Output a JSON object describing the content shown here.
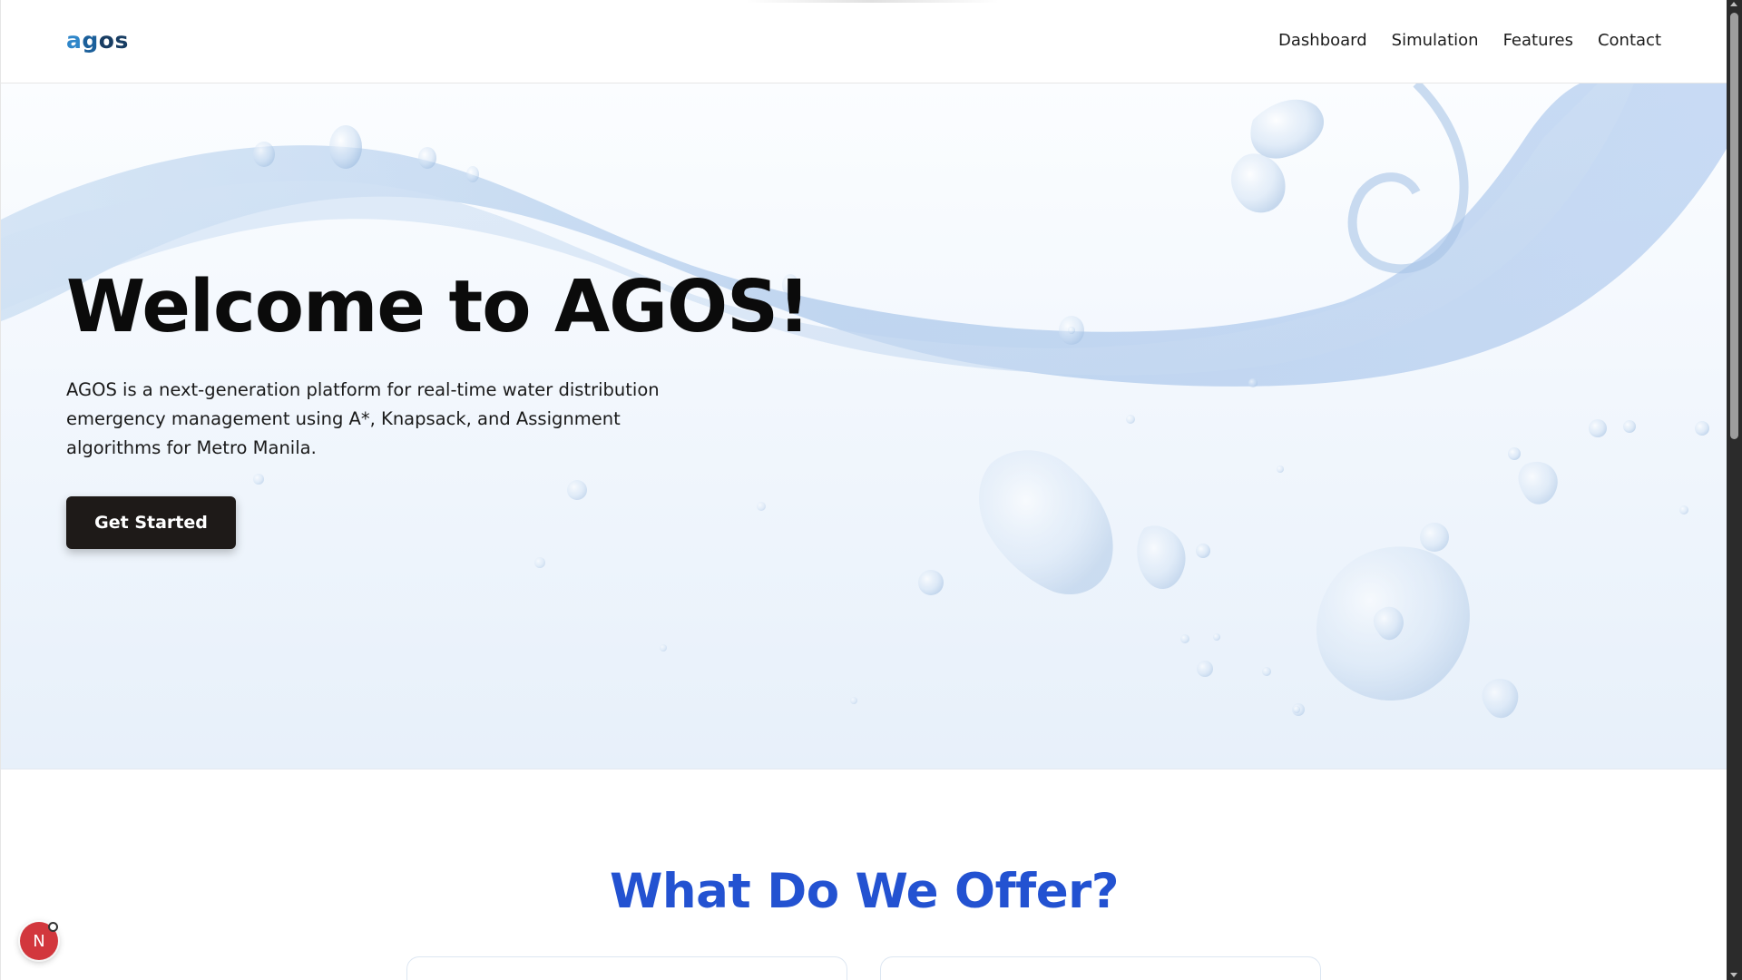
{
  "header": {
    "logo": {
      "part1": "a",
      "part2": "g",
      "part3": "os"
    },
    "nav": [
      {
        "label": "Dashboard"
      },
      {
        "label": "Simulation"
      },
      {
        "label": "Features"
      },
      {
        "label": "Contact"
      }
    ]
  },
  "hero": {
    "title": "Welcome to AGOS!",
    "description": "AGOS is a next-generation platform for real-time water distribution emergency management using A*, Knapsack, and Assignment algorithms for Metro Manila.",
    "cta_label": "Get Started"
  },
  "offer": {
    "title": "What Do We Offer?"
  },
  "badge": {
    "letter": "N"
  },
  "colors": {
    "accent_blue": "#2352d1",
    "button_dark": "#1e1a18",
    "logo_light": "#2f86c9",
    "logo_dark": "#183d63",
    "badge_red": "#d2373d"
  }
}
